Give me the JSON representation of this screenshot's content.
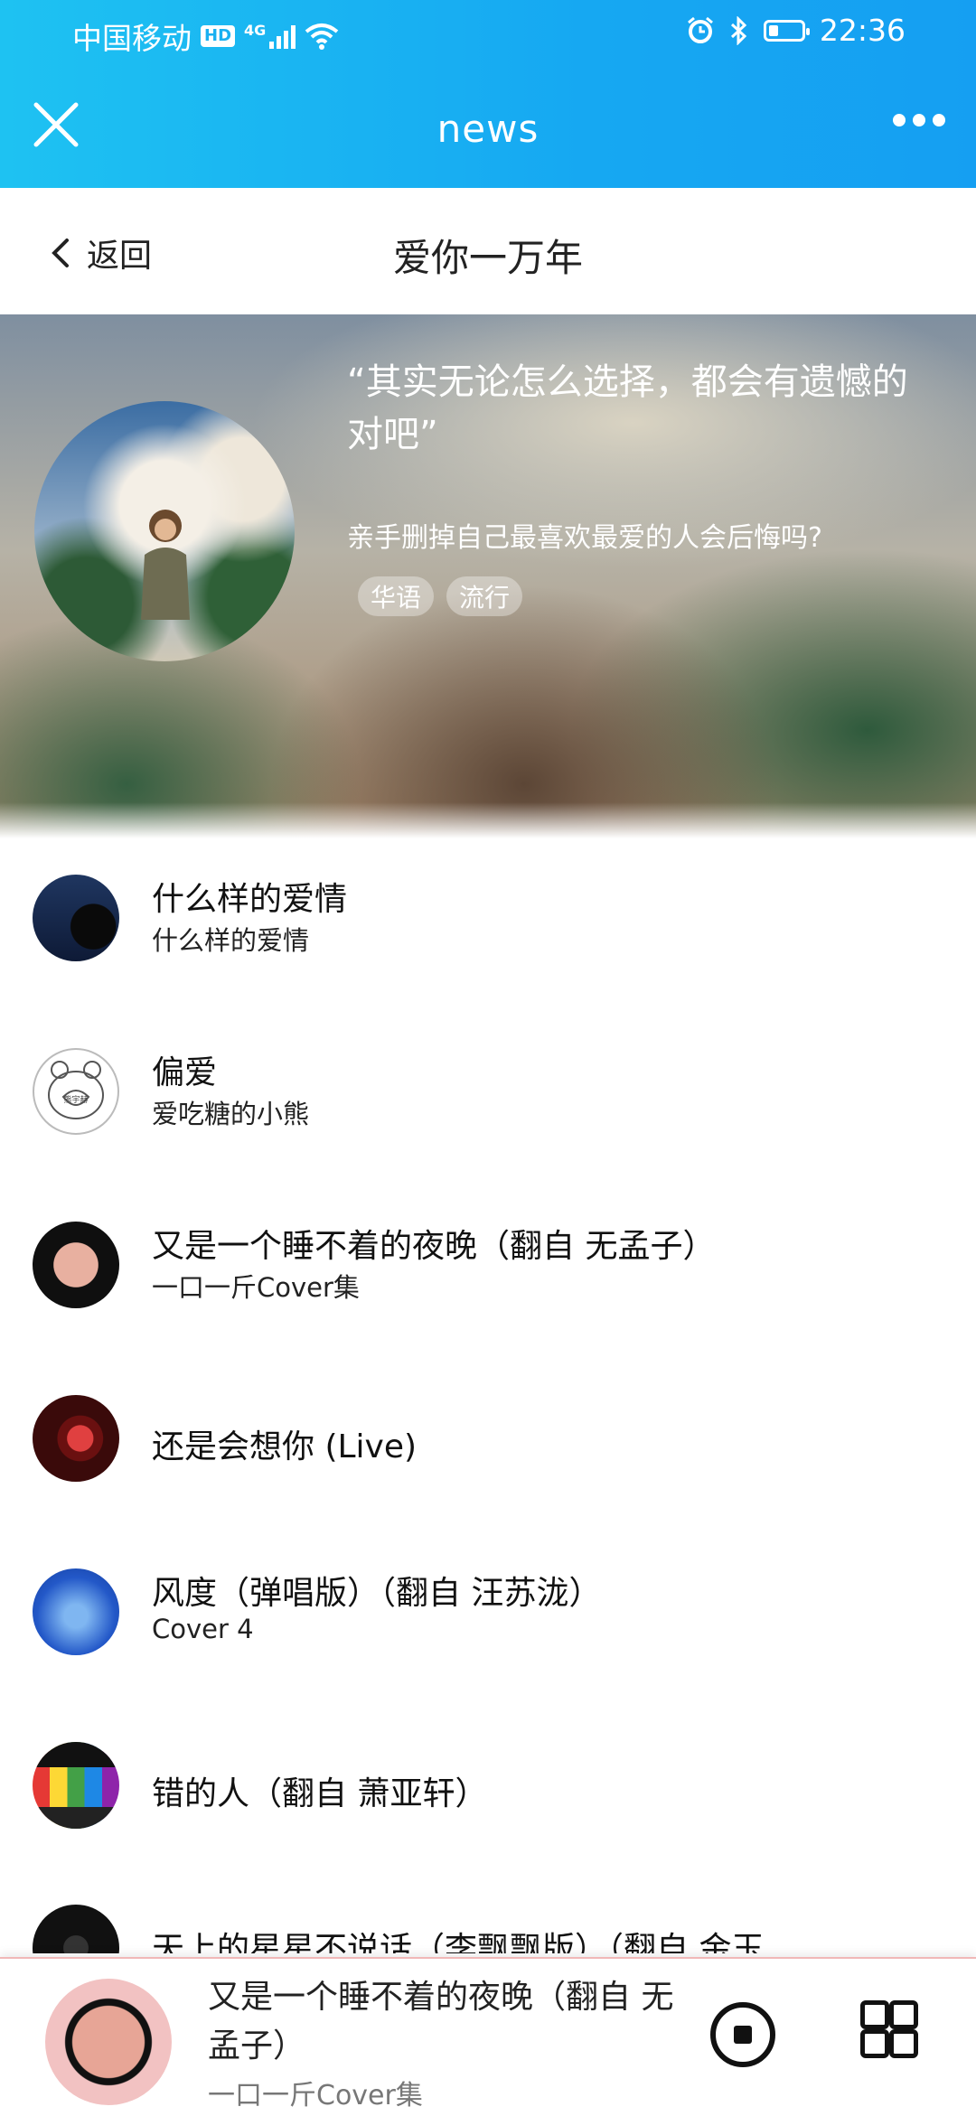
{
  "status": {
    "carrier": "中国移动",
    "hd": "HD",
    "network": "4G",
    "time": "22:36"
  },
  "header": {
    "title": "news"
  },
  "subheader": {
    "back_label": "返回",
    "title": "爱你一万年"
  },
  "playlist": {
    "quote": "“其实无论怎么选择，都会有遗憾的对吧”",
    "description": "亲手删掉自己最喜欢最爱的人会后悔吗?",
    "tags": [
      "华语",
      "流行"
    ]
  },
  "songs": [
    {
      "title": "什么样的爱情",
      "artist": "什么样的爱情"
    },
    {
      "title": "偏爱",
      "artist": "爱吃糖的小熊",
      "badge": "熊宇赫"
    },
    {
      "title": "又是一个睡不着的夜晚（翻自 无孟子）",
      "artist": "一口一斤Cover集"
    },
    {
      "title": "还是会想你 (Live)",
      "artist": ""
    },
    {
      "title": "风度（弹唱版）（翻自 汪苏泷）",
      "artist": "Cover 4"
    },
    {
      "title": "错的人（翻自 萧亚轩）",
      "artist": ""
    },
    {
      "title": "天上的星星不说话（李飘飘版）（翻自 金玉",
      "artist": ""
    }
  ],
  "player": {
    "title": "又是一个睡不着的夜晚（翻自 无孟子）",
    "artist": "一口一斤Cover集"
  },
  "icons": [
    "close-icon",
    "more-icon",
    "back-chevron-icon",
    "stop-icon",
    "grid-icon",
    "alarm-icon",
    "bluetooth-icon",
    "wifi-icon",
    "battery-icon"
  ],
  "colors": {
    "accent": "#16a8f2"
  }
}
